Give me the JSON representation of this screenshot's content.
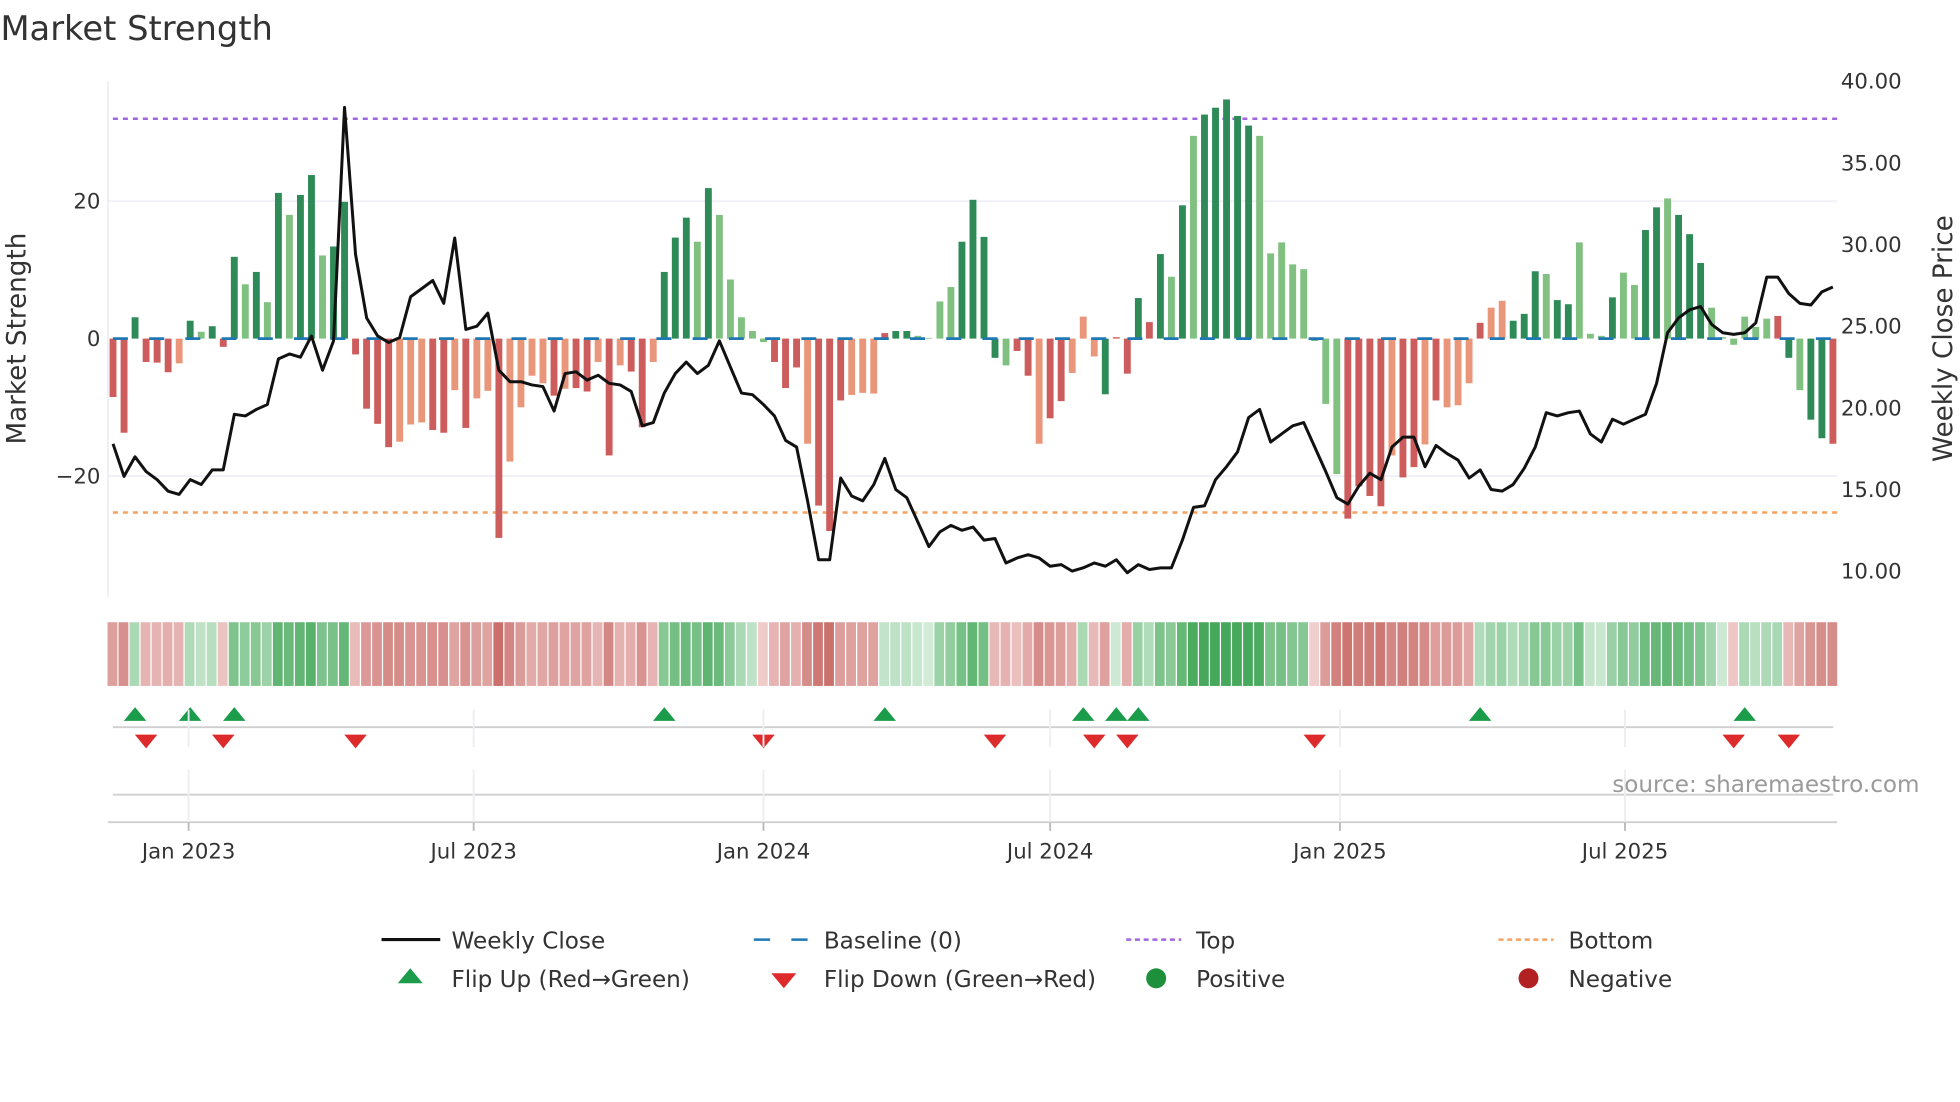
{
  "title": "Market Strength",
  "source": "source: sharemaestro.com",
  "chart_data": {
    "type": "bar",
    "title": "Market Strength",
    "x_start": "2022-11-14",
    "x_step_days": 7,
    "ylabel": "Market Strength",
    "y2label": "Weekly Close Price",
    "ylim": [
      -38.5,
      37.5
    ],
    "y2lim": [
      8.0,
      40.0
    ],
    "yticks": [
      "20",
      "0",
      "−20"
    ],
    "ytick_values": [
      20,
      0,
      -20
    ],
    "y2ticks": [
      "40.00",
      "35.00",
      "30.00",
      "25.00",
      "20.00",
      "15.00",
      "10.00"
    ],
    "y2tick_values": [
      40,
      35,
      30,
      25,
      20,
      15,
      10
    ],
    "xticks": [
      {
        "label": "Jan 2023",
        "date": "2023-01-01"
      },
      {
        "label": "Jul 2023",
        "date": "2023-07-01"
      },
      {
        "label": "Jan 2024",
        "date": "2024-01-01"
      },
      {
        "label": "Jul 2024",
        "date": "2024-07-01"
      },
      {
        "label": "Jan 2025",
        "date": "2025-01-01"
      },
      {
        "label": "Jul 2025",
        "date": "2025-07-01"
      }
    ],
    "top_level": 32,
    "bottom_level": -25.3,
    "baseline": 0,
    "strength": [
      -8.5,
      -13.7,
      3.1,
      -3.4,
      -3.5,
      -4.9,
      -3.6,
      2.6,
      1.0,
      1.8,
      -1.2,
      11.9,
      7.9,
      9.7,
      5.3,
      21.2,
      18.0,
      20.9,
      23.8,
      12.1,
      13.4,
      19.9,
      -2.3,
      -10.2,
      -12.4,
      -15.8,
      -15.0,
      -12.5,
      -12.2,
      -13.3,
      -13.7,
      -7.5,
      -13.0,
      -8.7,
      -7.6,
      -29.0,
      -17.9,
      -10.0,
      -5.4,
      -6.5,
      -8.3,
      -7.3,
      -7.2,
      -7.7,
      -3.4,
      -17.0,
      -3.9,
      -4.8,
      -12.9,
      -3.4,
      9.7,
      14.7,
      17.6,
      14.1,
      21.9,
      18.0,
      8.6,
      3.1,
      1.1,
      -0.5,
      -3.4,
      -7.2,
      -4.2,
      -15.3,
      -24.3,
      -28.0,
      -9.0,
      -8.2,
      -7.9,
      -8.0,
      0.8,
      1.1,
      1.1,
      0.4,
      0.1,
      5.4,
      7.5,
      14.1,
      20.2,
      14.8,
      -2.8,
      -3.9,
      -1.8,
      -5.4,
      -15.3,
      -11.6,
      -9.1,
      -5.0,
      3.2,
      -2.6,
      -8.1,
      0.2,
      -5.1,
      5.9,
      2.4,
      12.3,
      9.0,
      19.4,
      29.5,
      32.6,
      33.6,
      34.8,
      32.4,
      31.0,
      29.5,
      12.4,
      14.0,
      10.8,
      10.1,
      -0.3,
      -9.5,
      -19.7,
      -26.2,
      -21.5,
      -22.9,
      -24.4,
      -17.0,
      -20.2,
      -18.7,
      -15.4,
      -9.0,
      -10.0,
      -9.7,
      -6.5,
      2.3,
      4.5,
      5.5,
      2.6,
      3.6,
      9.8,
      9.4,
      5.6,
      5.0,
      14.0,
      0.7,
      0.4,
      6.0,
      9.6,
      7.8,
      15.8,
      19.1,
      20.4,
      18.0,
      15.2,
      11.0,
      4.5,
      0.2,
      -0.9,
      3.2,
      1.7,
      2.9,
      3.3,
      -2.8,
      -7.5,
      -11.8,
      -14.5,
      -15.3
    ],
    "tones": "RRGRRRrGgGRGgGgGgGGgGGRRRRrrrRRrRrrRrrrrRrRRrRrRRrGGGgGgggggRRRrRRRrrrRGGggggGGGGgRRrRRrrrGRRGRGgGgGGGGGgggggGggRRRRrRRrRrrrRrrGGGgGGgggGggGGgGGGggggggRGgGGRRRRR",
    "weekly_close": [
      17.8,
      15.8,
      17.0,
      16.1,
      15.6,
      14.9,
      14.7,
      15.6,
      15.3,
      16.2,
      16.2,
      19.6,
      19.5,
      19.9,
      20.2,
      23.0,
      23.3,
      23.1,
      24.4,
      22.3,
      24.1,
      38.4,
      29.4,
      25.5,
      24.4,
      24.0,
      24.3,
      26.8,
      27.3,
      27.8,
      26.4,
      30.4,
      24.8,
      25.0,
      25.8,
      22.3,
      21.6,
      21.6,
      21.4,
      21.3,
      19.8,
      22.1,
      22.2,
      21.7,
      22.0,
      21.5,
      21.4,
      21.0,
      18.9,
      19.1,
      20.9,
      22.1,
      22.8,
      22.1,
      22.6,
      24.1,
      22.5,
      20.9,
      20.8,
      20.2,
      19.5,
      18.0,
      17.6,
      14.3,
      10.7,
      10.7,
      15.7,
      14.6,
      14.3,
      15.3,
      16.9,
      15.0,
      14.5,
      13.0,
      11.5,
      12.4,
      12.8,
      12.5,
      12.7,
      11.9,
      12.0,
      10.5,
      10.8,
      11.0,
      10.8,
      10.3,
      10.4,
      10.0,
      10.2,
      10.5,
      10.3,
      10.7,
      9.9,
      10.4,
      10.1,
      10.2,
      10.2,
      11.9,
      13.9,
      14.0,
      15.6,
      16.4,
      17.3,
      19.4,
      19.9,
      17.9,
      18.4,
      18.9,
      19.1,
      17.6,
      16.1,
      14.5,
      14.1,
      15.2,
      16.0,
      15.6,
      17.6,
      18.2,
      18.2,
      16.4,
      17.7,
      17.2,
      16.8,
      15.7,
      16.2,
      15.0,
      14.9,
      15.3,
      16.3,
      17.6,
      19.7,
      19.5,
      19.7,
      19.8,
      18.4,
      17.9,
      19.3,
      19.0,
      19.3,
      19.6,
      21.5,
      24.6,
      25.5,
      26.0,
      26.2,
      25.1,
      24.6,
      24.5,
      24.6,
      25.2,
      28.0,
      28.0,
      27.0,
      26.4,
      26.3,
      27.1,
      27.4
    ],
    "flip_up_weeks": [
      3,
      8,
      12,
      51,
      71,
      89,
      92,
      94,
      125,
      149
    ],
    "flip_down_weeks": [
      4,
      11,
      23,
      60,
      81,
      90,
      93,
      110,
      148,
      153
    ],
    "legend": [
      {
        "label": "Weekly Close",
        "symbol": "line"
      },
      {
        "label": "Baseline (0)",
        "symbol": "dash"
      },
      {
        "label": "Top",
        "symbol": "dot"
      },
      {
        "label": "Bottom",
        "symbol": "dot"
      },
      {
        "label": "Flip Up (Red→Green)",
        "symbol": "triangle-up"
      },
      {
        "label": "Flip Down (Green→Red)",
        "symbol": "triangle-down"
      },
      {
        "label": "Positive",
        "symbol": "circle"
      },
      {
        "label": "Negative",
        "symbol": "circle"
      }
    ],
    "legend_placement": "bottom",
    "colors": {
      "strong_up": "#2e8b57",
      "weak_up": "#80c080",
      "strong_down": "#cd5c5c",
      "weak_down": "#e9967a",
      "close": "#111111",
      "baseline": "#1f77b4",
      "top": "#a066e0",
      "bottom": "#f4a261",
      "flip_up": "#1a9c4a",
      "flip_down": "#dd2a2a",
      "positive": "#1e8f3a",
      "negative": "#b22222"
    }
  }
}
